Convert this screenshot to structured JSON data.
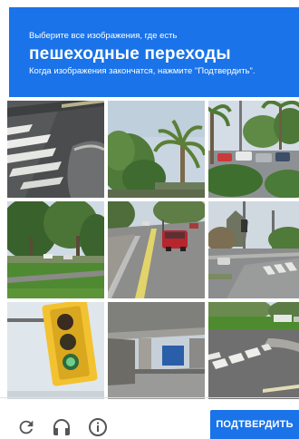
{
  "header": {
    "instruction": "Выберите все изображения, где есть",
    "target": "пешеходные переходы",
    "note": "Когда изображения закончатся, нажмите \"Подтвердить\".",
    "background_color": "#1a73e8"
  },
  "grid": {
    "rows": 3,
    "columns": 3,
    "tiles": [
      {
        "row": 1,
        "col": 1,
        "content": "crosswalk-stripes-on-asphalt"
      },
      {
        "row": 1,
        "col": 2,
        "content": "palm-tree-and-trees"
      },
      {
        "row": 1,
        "col": 3,
        "content": "palms-and-parking-lot"
      },
      {
        "row": 2,
        "col": 1,
        "content": "green-lawn-and-trees"
      },
      {
        "row": 2,
        "col": 2,
        "content": "road-with-red-car"
      },
      {
        "row": 2,
        "col": 3,
        "content": "street-intersection-with-crosswalk"
      },
      {
        "row": 3,
        "col": 1,
        "content": "yellow-traffic-light"
      },
      {
        "row": 3,
        "col": 2,
        "content": "highway-overpass"
      },
      {
        "row": 3,
        "col": 3,
        "content": "road-with-crosswalk"
      }
    ]
  },
  "controls": {
    "reload_icon": "reload-icon",
    "audio_icon": "headphones-icon",
    "info_icon": "info-icon"
  },
  "verify_button": {
    "label": "ПОДТВЕРДИТЬ",
    "color": "#1a73e8"
  }
}
